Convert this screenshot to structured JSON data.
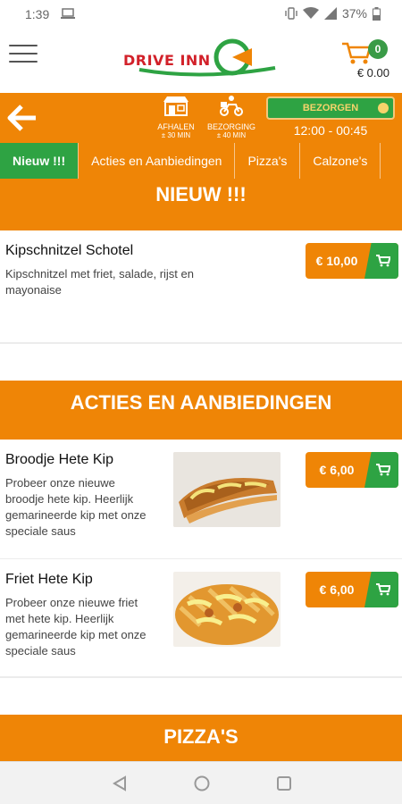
{
  "status": {
    "time": "1:39",
    "battery": "37%"
  },
  "header": {
    "logo_text": "DRIVE INN",
    "cart_count": "0",
    "cart_total": "€ 0.00"
  },
  "orderbar": {
    "pickup_label": "AFHALEN",
    "pickup_time": "± 30 MIN",
    "delivery_label": "BEZORGING",
    "delivery_time": "± 40 MIN",
    "selected_mode": "BEZORGEN",
    "hours": "12:00 - 00:45"
  },
  "tabs": [
    "Nieuw !!!",
    "Acties en Aanbiedingen",
    "Pizza's",
    "Calzone's"
  ],
  "sections": {
    "nieuw": {
      "title": "NIEUW !!!",
      "items": [
        {
          "title": "Kipschnitzel Schotel",
          "desc_1": "Kipschnitzel met friet, salade, rijst en",
          "desc_2": "mayonaise",
          "price": "€ 10,00"
        }
      ]
    },
    "acties": {
      "title": "ACTIES EN AANBIEDINGEN",
      "items": [
        {
          "title": "Broodje Hete Kip",
          "desc_1": "Probeer onze nieuwe",
          "desc_2": "broodje hete kip. Heerlijk",
          "desc_3": "gemarineerde kip met onze",
          "desc_4": "speciale saus",
          "price": "€ 6,00"
        },
        {
          "title": "Friet Hete Kip",
          "desc_1": "Probeer onze nieuwe friet",
          "desc_2": "met hete kip. Heerlijk",
          "desc_3": "gemarineerde kip met onze",
          "desc_4": "speciale saus",
          "price": "€ 6,00"
        }
      ]
    },
    "pizzas": {
      "title": "PIZZA'S"
    }
  },
  "colors": {
    "orange": "#ef8506",
    "green": "#2ea343",
    "logo_red": "#d2212a"
  },
  "icons": [
    "menu-icon",
    "cart-icon",
    "back-arrow-icon",
    "store-icon",
    "scooter-icon",
    "chevron-down-icon",
    "nav-back-icon",
    "nav-home-icon",
    "nav-recents-icon"
  ]
}
